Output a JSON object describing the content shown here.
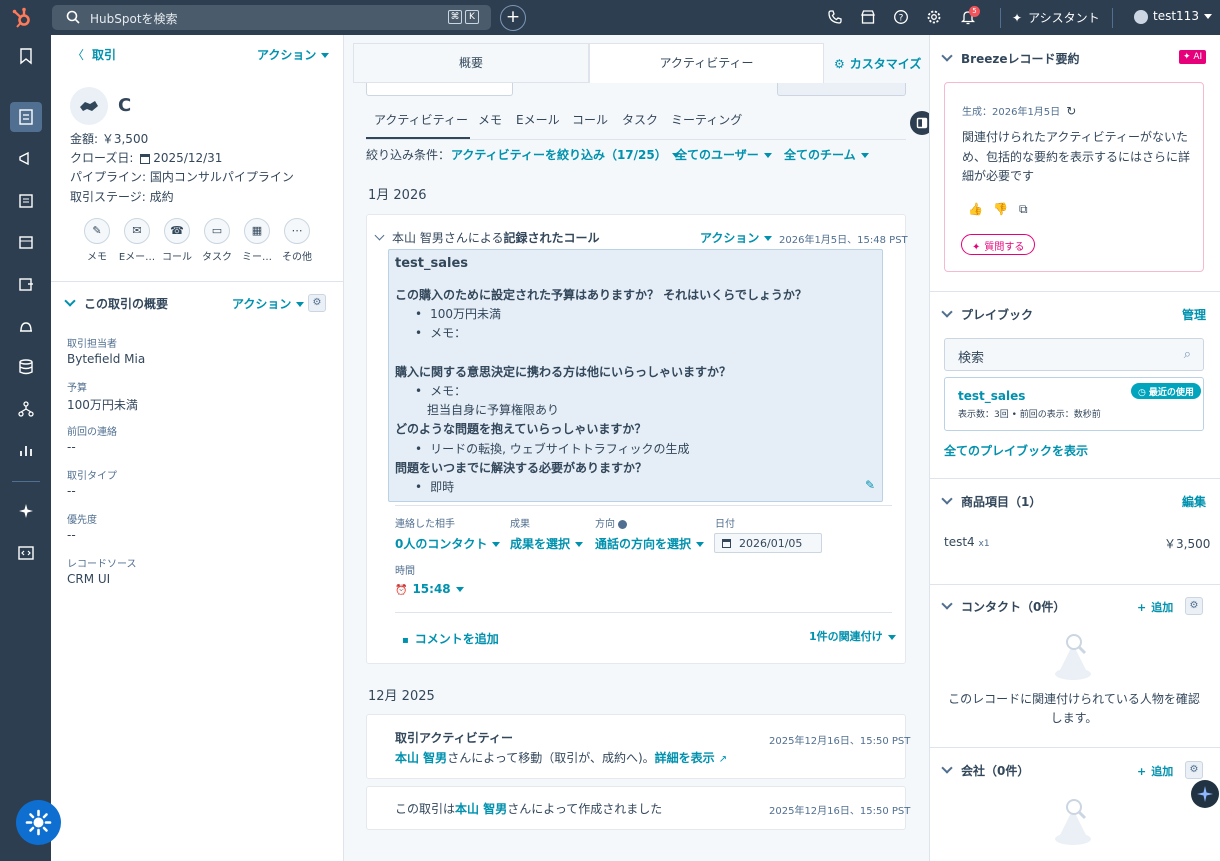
{
  "topbar": {
    "search_placeholder": "HubSpotを検索",
    "kbd1": "⌘",
    "kbd2": "K",
    "assistant": "アシスタント",
    "user": "test113",
    "notif_count": "5"
  },
  "left": {
    "back_label": "取引",
    "action_label": "アクション",
    "deal_name": "C",
    "amount": "金額: ￥3,500",
    "close_label": "クローズ日:",
    "close_date": "2025/12/31",
    "pipeline": "パイプライン: 国内コンサルパイプライン",
    "stage": "取引ステージ: 成約",
    "quick_actions": [
      {
        "label": "メモ"
      },
      {
        "label": "Eメー…"
      },
      {
        "label": "コール"
      },
      {
        "label": "タスク"
      },
      {
        "label": "ミー…"
      },
      {
        "label": "その他"
      }
    ],
    "overview_title": "この取引の概要",
    "overview_action": "アクション",
    "fields": [
      {
        "label": "取引担当者",
        "value": "Bytefield Mia"
      },
      {
        "label": "予算",
        "value": "100万円未満"
      },
      {
        "label": "前回の連絡",
        "value": "--"
      },
      {
        "label": "取引タイプ",
        "value": "--"
      },
      {
        "label": "優先度",
        "value": "--"
      },
      {
        "label": "レコードソース",
        "value": "CRM UI"
      }
    ]
  },
  "middle": {
    "tab_overview": "概要",
    "tab_activity": "アクティビティー",
    "customize": "カスタマイズ",
    "subtabs": [
      "アクティビティー",
      "メモ",
      "Eメール",
      "コール",
      "タスク",
      "ミーティング"
    ],
    "filter_label": "絞り込み条件：",
    "filter_activity": "アクティビティーを絞り込み（17/25）",
    "filter_users": "全てのユーザー",
    "filter_teams": "全てのチーム",
    "month1": "1月 2026",
    "month2": "12月 2025",
    "call": {
      "header_pre": "本山 智男さんによる",
      "header_bold": "記録されたコール",
      "action": "アクション",
      "timestamp": "2026年1月5日、15:48 PST",
      "title": "test_sales",
      "q1": "この購入のために設定された予算はありますか？ それはいくらでしょうか？",
      "q1a": "100万円未満",
      "q1b": "メモ：",
      "q2": "購入に関する意思決定に携わる方は他にいらっしゃいますか？",
      "q2a": "メモ：",
      "q2b": "担当自身に予算権限あり",
      "q3": "どのような問題を抱えていらっしゃいますか？",
      "q3a": "リードの転換, ウェブサイトトラフィックの生成",
      "q4": "問題をいつまでに解決する必要がありますか？",
      "q4a": "即時",
      "contacted_label": "連絡した相手",
      "contacted_value": "0人のコンタクト",
      "outcome_label": "成果",
      "outcome_value": "成果を選択",
      "direction_label": "方向",
      "direction_value": "通話の方向を選択",
      "date_label": "日付",
      "date_value": "2026/01/05",
      "time_label": "時間",
      "time_value": "15:48",
      "comment": "コメントを追加",
      "assoc": "1件の関連付け"
    },
    "deal_activity": {
      "title": "取引アクティビティー",
      "timestamp": "2025年12月16日、15:50 PST",
      "user": "本山 智男",
      "text": "さんによって移動（取引が、成約へ)。",
      "detail": "詳細を表示"
    },
    "created": {
      "pre": "この取引は",
      "user": "本山 智男",
      "post": "さんによって作成されました",
      "timestamp": "2025年12月16日、15:50 PST"
    }
  },
  "right": {
    "breeze_title": "Breezeレコード要約",
    "ai_badge": "✦ AI",
    "generated": "生成：2026年1月5日",
    "summary": "関連付けられたアクティビティーがないため、包括的な要約を表示するにはさらに詳細が必要です",
    "ask": "質問する",
    "playbook_title": "プレイブック",
    "playbook_manage": "管理",
    "playbook_search": "検索",
    "playbook_name": "test_sales",
    "playbook_badge": "最近の使用",
    "playbook_meta": "表示数：3回 • 前回の表示：数秒前",
    "playbook_all": "全てのプレイブックを表示",
    "products_title": "商品項目（1）",
    "products_edit": "編集",
    "product_name": "test4",
    "product_qty": "x1",
    "product_price": "￥3,500",
    "contacts_title": "コンタクト（0件）",
    "add": "追加",
    "contacts_empty": "このレコードに関連付けられている人物を確認します。",
    "companies_title": "会社（0件）"
  },
  "colors": {
    "topbar": "#2d3e50",
    "accent": "#0091ae",
    "ai": "#e6007a"
  }
}
